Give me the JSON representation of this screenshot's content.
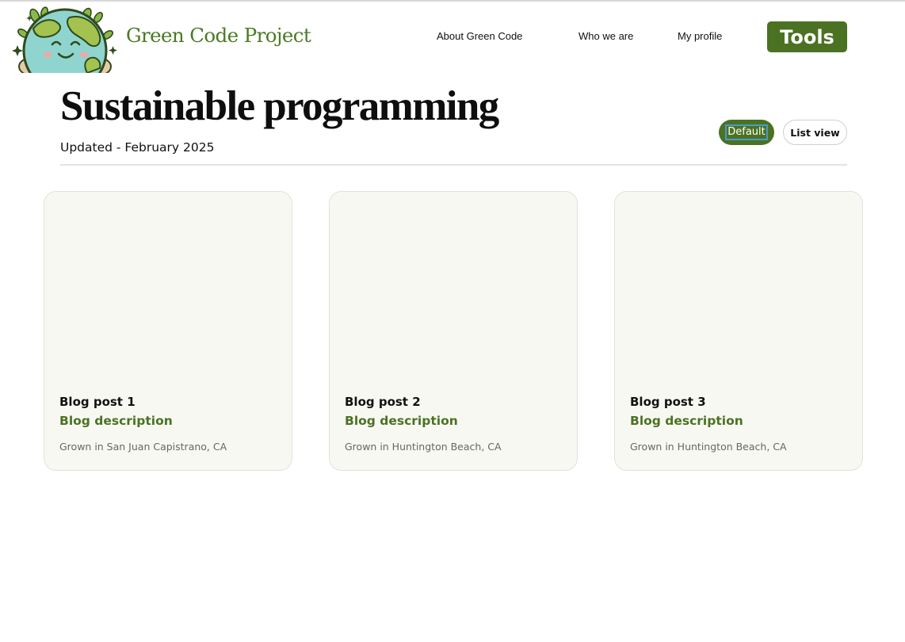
{
  "brand": {
    "name": "Green Code Project",
    "logo_icon": "smiling-earth-icon"
  },
  "nav": {
    "items": [
      {
        "label": "About Green Code"
      },
      {
        "label": "Who we are"
      },
      {
        "label": "My profile"
      }
    ],
    "tools_label": "Tools"
  },
  "header": {
    "title": "Sustainable programming",
    "updated": "Updated - February 2025"
  },
  "view_toggle": {
    "default_label": "Default",
    "list_label": "List view",
    "selected": "Default"
  },
  "cards": [
    {
      "title": "Blog post 1",
      "description": "Blog description",
      "location": "Grown in San Juan Capistrano, CA"
    },
    {
      "title": "Blog post 2",
      "description": "Blog description",
      "location": "Grown in Huntington Beach, CA"
    },
    {
      "title": "Blog post 3",
      "description": "Blog description",
      "location": "Grown in Huntington Beach, CA"
    }
  ],
  "colors": {
    "brand_green": "#4a7222",
    "brand_text_green": "#4a7a23",
    "card_background": "#f8f8f3",
    "focus_outline": "#4a9ac9"
  }
}
